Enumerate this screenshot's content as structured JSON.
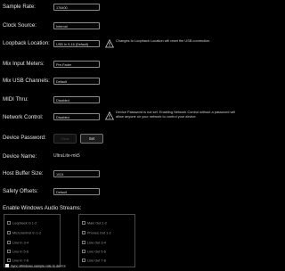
{
  "settings": {
    "sample_rate": {
      "label": "Sample Rate:",
      "value": "176400"
    },
    "clock_source": {
      "label": "Clock Source:",
      "value": "Internal"
    },
    "loopback_location": {
      "label": "Loopback Location:",
      "value": "USB In 9-16 (Default)",
      "warning": "Changes to Loopback Location will reset the USB connection."
    },
    "mix_input_meters": {
      "label": "Mix Input Meters:",
      "value": "Pre-Fader"
    },
    "mix_usb_channels": {
      "label": "Mix USB Channels:",
      "value": "Default"
    },
    "midi_thru": {
      "label": "MIDI Thru:",
      "value": "Disabled"
    },
    "network_control": {
      "label": "Network Control:",
      "value": "Disabled",
      "warning": "Device Password is not set. Enabling Network Control without a password will allow anyone on your network to control your device."
    },
    "device_password": {
      "label": "Device Password:",
      "field_text": "Clear",
      "set_label": "Set"
    },
    "device_name": {
      "label": "Device Name:",
      "value": "UltraLite-mk5"
    },
    "host_buffer_size": {
      "label": "Host Buffer Size:",
      "value": "1024"
    },
    "safety_offsets": {
      "label": "Safety Offsets:",
      "value": "Default"
    }
  },
  "streams": {
    "label": "Enable Windows Audio Streams:",
    "inputs": [
      {
        "label": "Loopback In 1-2",
        "checked": false
      },
      {
        "label": "Mic/Line/Inst In 1-2",
        "checked": false
      },
      {
        "label": "Line In 3-4",
        "checked": false
      },
      {
        "label": "Line In 5-6",
        "checked": false
      },
      {
        "label": "Line In 7-8",
        "checked": false
      }
    ],
    "outputs": [
      {
        "label": "Main Out 1-2",
        "checked": false
      },
      {
        "label": "Phones Out 1-2",
        "checked": false
      },
      {
        "label": "Line Out 3-4",
        "checked": false
      },
      {
        "label": "Line Out 5-6",
        "checked": false
      },
      {
        "label": "Line Out 7-8",
        "checked": false
      }
    ],
    "sync_label": "Sync Windows sample rate to device",
    "sync_checked": true
  },
  "colors": {
    "background": "#000000",
    "text": "#e6e6e6",
    "field_border": "#8a8a8a",
    "warning": "#d9d9d9"
  },
  "icons": {
    "warning": "warning-triangle-icon"
  }
}
